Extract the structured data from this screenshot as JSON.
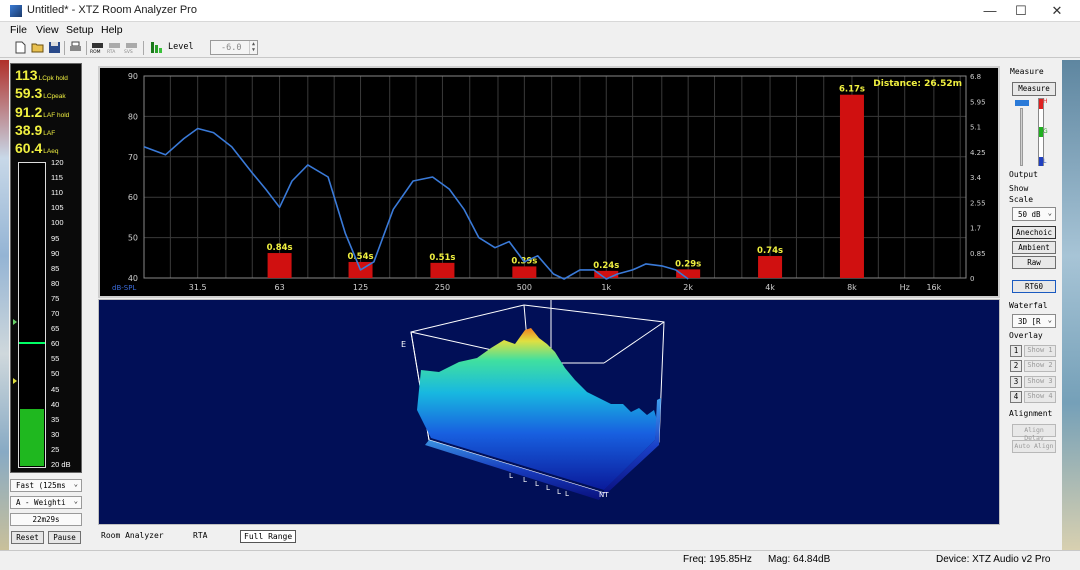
{
  "window": {
    "title": "Untitled* - XTZ Room Analyzer Pro",
    "controls": [
      "—",
      "☐",
      "✕"
    ]
  },
  "menu": [
    "File",
    "View",
    "Setup",
    "Help"
  ],
  "toolbar": {
    "level_label": "Level",
    "level_value": "-6.0",
    "small_buttons": [
      "ROM",
      "RTA",
      "SVS"
    ]
  },
  "meter": {
    "readouts": [
      {
        "value": "113",
        "label": "LCpk hold"
      },
      {
        "value": "59.3",
        "label": "LCpeak"
      },
      {
        "value": "91.2",
        "label": "LAF hold"
      },
      {
        "value": "38.9",
        "label": "LAF"
      },
      {
        "value": "60.4",
        "label": "LAeq"
      }
    ],
    "scale": [
      "120",
      "115",
      "110",
      "105",
      "100",
      "95",
      "90",
      "85",
      "80",
      "75",
      "70",
      "65",
      "60",
      "55",
      "50",
      "45",
      "40",
      "35",
      "30",
      "25",
      "20 dB"
    ],
    "level_db": 38.9,
    "marker_db": 60.4,
    "response": "Fast (125ms",
    "weighting": "A - Weighti",
    "time": "22m29s",
    "reset_label": "Reset",
    "pause_label": "Pause"
  },
  "chart_data": {
    "type": "bar",
    "title": "",
    "annotation": "Distance: 26.52m",
    "xlabel": "Hz",
    "ylabel": "dB-SPL",
    "x_ticks": [
      "31.5",
      "63",
      "125",
      "250",
      "500",
      "1k",
      "2k",
      "4k",
      "8k",
      "16k"
    ],
    "ylim": [
      40,
      90
    ],
    "y_ticks": [
      "90",
      "80",
      "70",
      "60",
      "50",
      "40"
    ],
    "y2lim": [
      0,
      6.8
    ],
    "y2_ticks": [
      "6.8",
      "5.95",
      "5.1",
      "4.25",
      "3.4",
      "2.55",
      "1.7",
      "0.85",
      "0"
    ],
    "series": [
      {
        "name": "RT60",
        "categories": [
          "63",
          "125",
          "250",
          "500",
          "1k",
          "2k",
          "4k",
          "8k"
        ],
        "values": [
          0.84,
          0.54,
          0.51,
          0.39,
          0.24,
          0.29,
          0.74,
          6.17
        ],
        "labels": [
          "0.84s",
          "0.54s",
          "0.51s",
          "0.39s",
          "0.24s",
          "0.29s",
          "0.74s",
          "6.17s"
        ],
        "color": "#d01010"
      },
      {
        "name": "SPL",
        "x_hz": [
          20,
          24,
          28,
          31.5,
          36,
          42,
          50,
          56,
          63,
          70,
          80,
          95,
          110,
          125,
          140,
          165,
          195,
          230,
          265,
          300,
          340,
          390,
          440,
          500,
          560,
          640,
          700,
          800,
          900,
          1000,
          1100,
          1250,
          1400,
          1600,
          1800,
          2000
        ],
        "values": [
          72.5,
          70.5,
          74.5,
          77,
          76,
          72.5,
          66,
          62,
          57.5,
          64,
          68,
          65,
          51,
          42,
          44,
          57,
          64,
          65,
          62,
          57,
          50,
          47.5,
          49,
          44,
          45.5,
          41,
          38,
          42,
          42,
          37,
          41,
          42,
          43.5,
          43,
          42,
          39
        ],
        "color": "#3a7ad8"
      }
    ],
    "grid": true,
    "background": "#000000",
    "text_color": "#f0f040"
  },
  "waterfall": {
    "axis_label_e": "E",
    "axis_label_nt": "NT",
    "tick_marks": [
      "L",
      "L",
      "L",
      "L",
      "L",
      "L"
    ],
    "background": "#010f57"
  },
  "tabs": [
    "Room Analyzer",
    "RTA",
    "Full Range"
  ],
  "status": {
    "freq": "Freq: 195.85Hz",
    "mag": "Mag: 64.84dB",
    "device": "Device: XTZ Audio v2 Pro"
  },
  "right_panel": {
    "measure_title": "Measure",
    "measure_button": "Measure",
    "meter_letters": [
      "H",
      "G",
      "L"
    ],
    "output_label": "Output",
    "show_scale_label": "Show\nScale",
    "scale_value": "50 dB",
    "anechoic_label": "Anechoic",
    "ambient_label": "Ambient",
    "raw_label": "Raw",
    "rt60_label": "RT60",
    "waterfall_label": "Waterfal",
    "waterfall_value": "3D [R",
    "overlay_label": "Overlay",
    "overlays": [
      {
        "num": "1",
        "label": "Show 1"
      },
      {
        "num": "2",
        "label": "Show 2"
      },
      {
        "num": "3",
        "label": "Show 3"
      },
      {
        "num": "4",
        "label": "Show 4"
      }
    ],
    "alignment_label": "Alignment",
    "align_delay_label": "Align Delay",
    "auto_align_label": "Auto Align"
  }
}
